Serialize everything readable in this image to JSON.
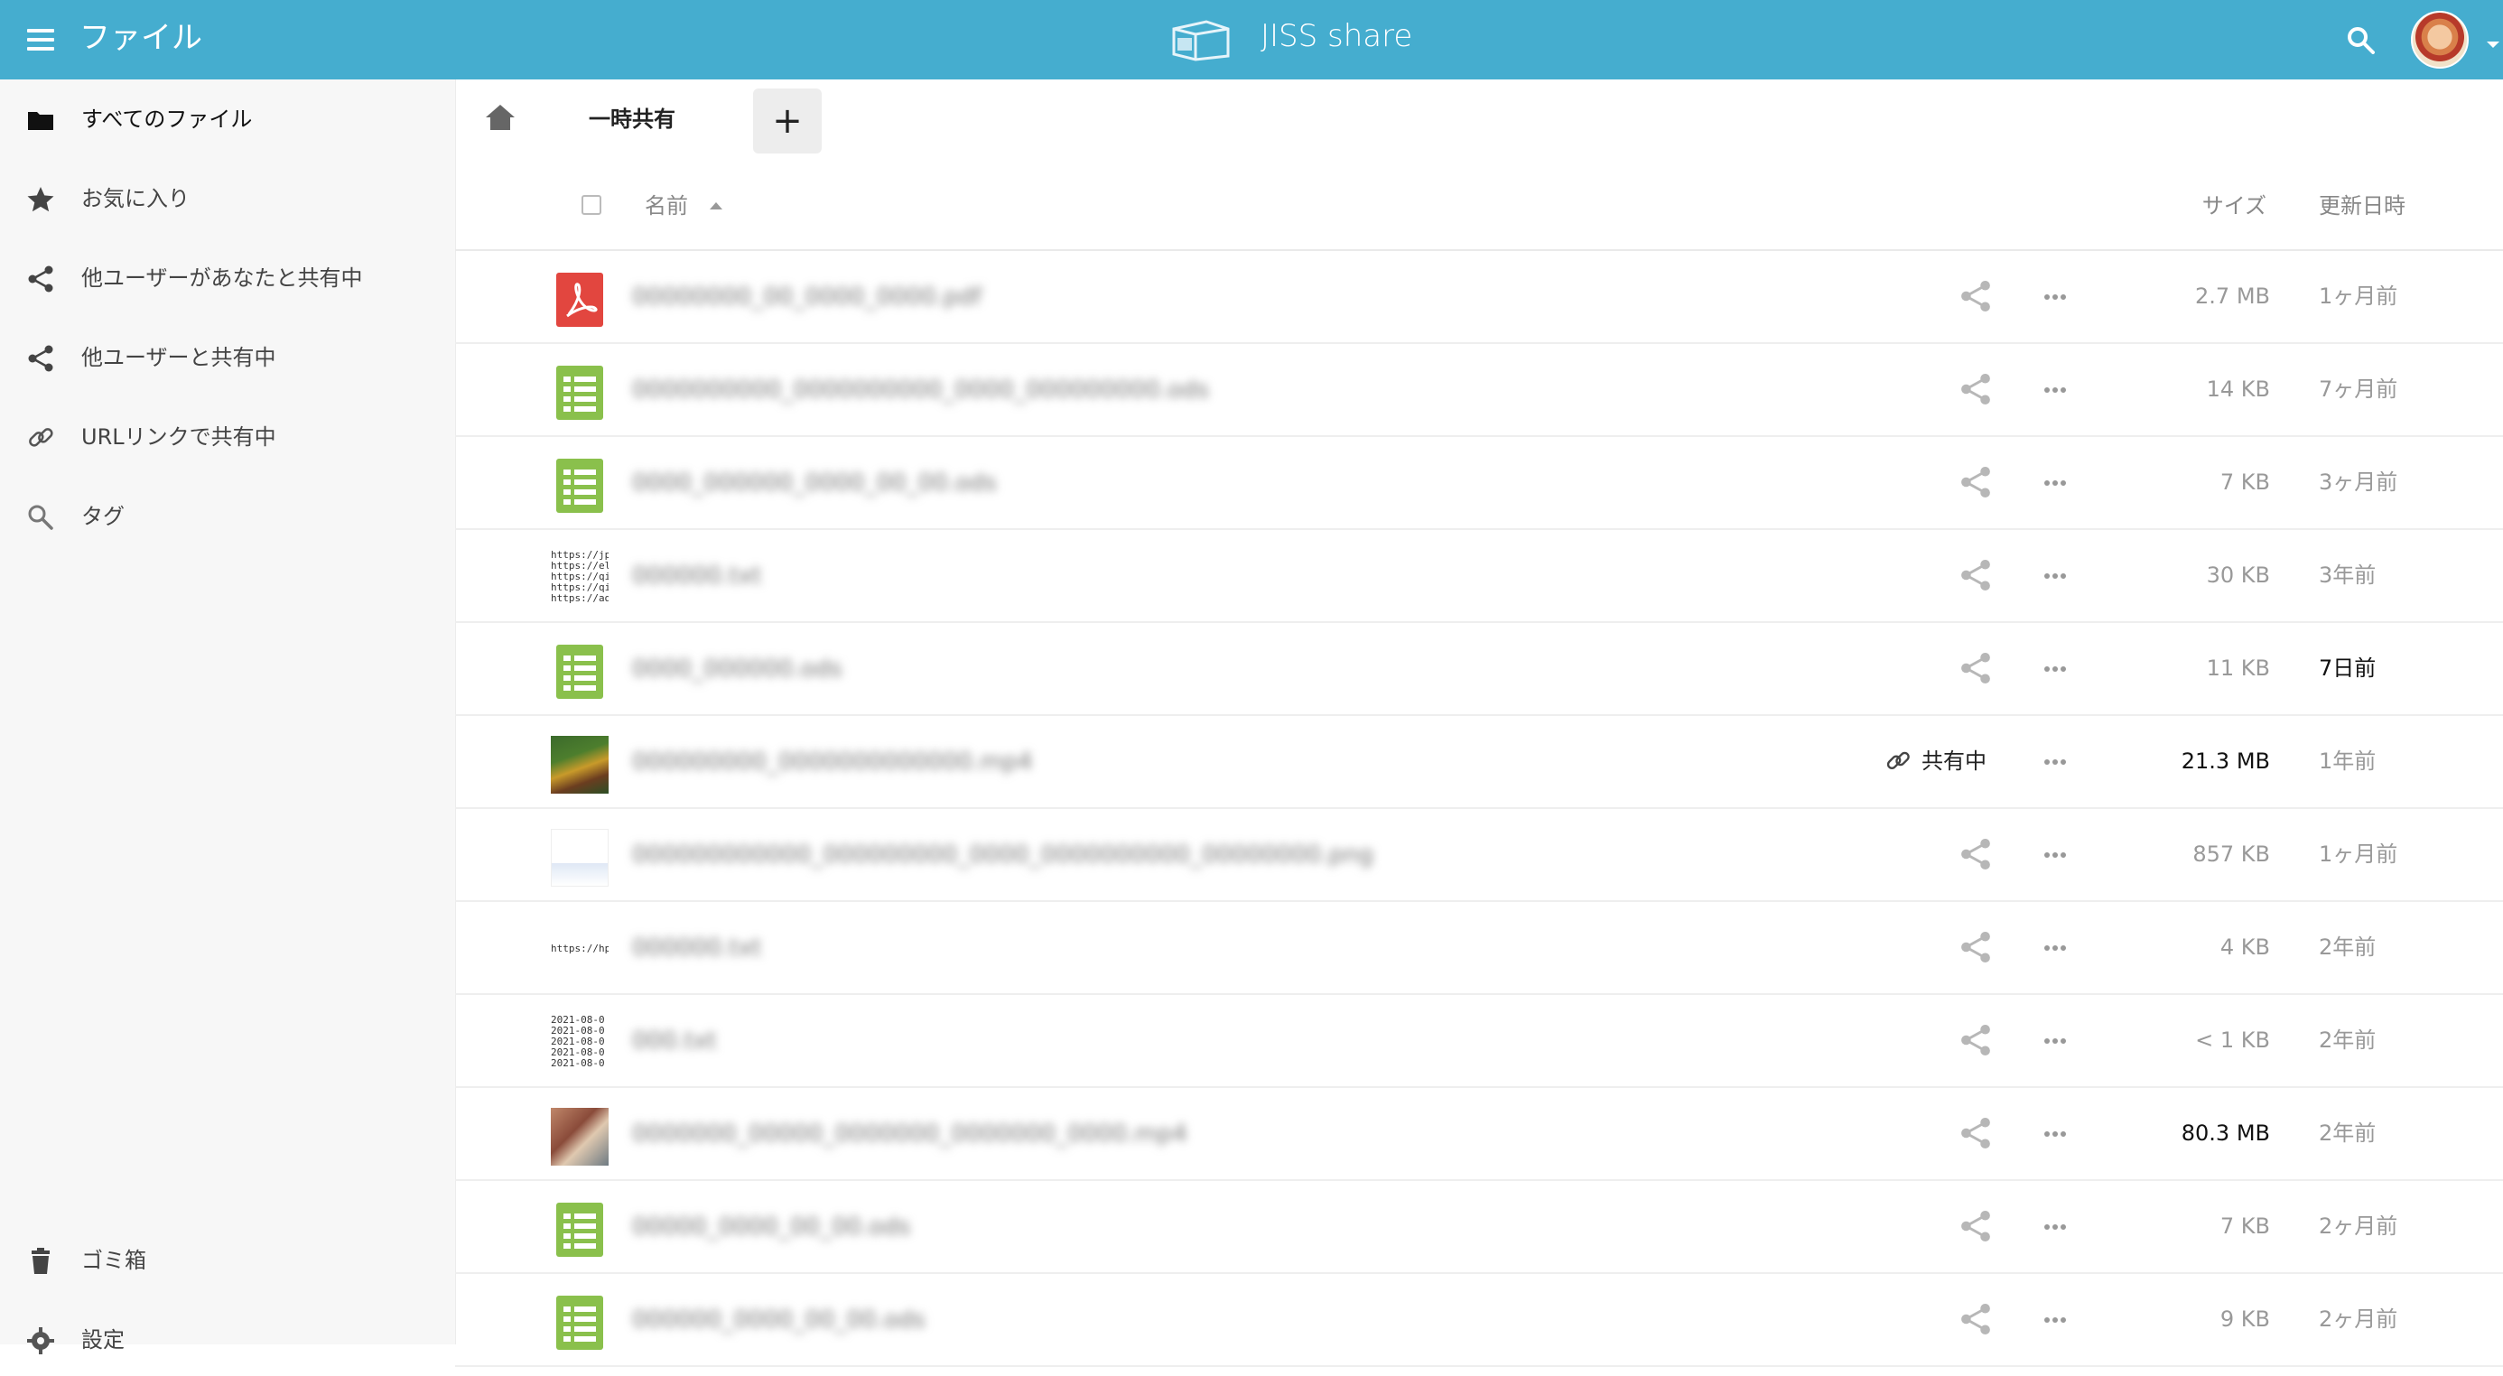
{
  "header": {
    "app_title": "ファイル",
    "brand": "JISS share",
    "accent_color": "#45adcf"
  },
  "sidebar": {
    "items": [
      {
        "label": "すべてのファイル",
        "icon": "folder-icon"
      },
      {
        "label": "お気に入り",
        "icon": "star-icon"
      },
      {
        "label": "他ユーザーがあなたと共有中",
        "icon": "share-icon"
      },
      {
        "label": "他ユーザーと共有中",
        "icon": "share-icon"
      },
      {
        "label": "URLリンクで共有中",
        "icon": "link-icon"
      },
      {
        "label": "タグ",
        "icon": "search-icon"
      }
    ],
    "bottom": [
      {
        "label": "ゴミ箱",
        "icon": "trash-icon"
      },
      {
        "label": "設定",
        "icon": "gear-icon"
      }
    ]
  },
  "breadcrumb": {
    "current": "一時共有",
    "add_label": "+"
  },
  "columns": {
    "name": "名前",
    "size": "サイズ",
    "modified": "更新日時"
  },
  "files": [
    {
      "name": "00000000_00_0000_0000.pdf",
      "type": "pdf",
      "size": "2.7 MB",
      "modified": "1ヶ月前"
    },
    {
      "name": "0000000000_0000000000_0000_000000000.ods",
      "type": "spreadsheet",
      "size": "14 KB",
      "modified": "7ヶ月前"
    },
    {
      "name": "0000_000000_0000_00_00.ods",
      "type": "spreadsheet",
      "size": "7 KB",
      "modified": "3ヶ月前"
    },
    {
      "name": "000000.txt",
      "type": "text",
      "size": "30 KB",
      "modified": "3年前"
    },
    {
      "name": "0000_000000.ods",
      "type": "spreadsheet",
      "size": "11 KB",
      "modified": "7日前",
      "modified_dark": true
    },
    {
      "name": "000000000_0000000000000.mp4",
      "type": "image",
      "size": "21.3 MB",
      "modified": "1年前",
      "shared": true,
      "shared_label": "共有中",
      "size_dark": true
    },
    {
      "name": "000000000000_000000000_0000_0000000000_00000000.png",
      "type": "screenshot",
      "size": "857 KB",
      "modified": "1ヶ月前"
    },
    {
      "name": "000000.txt",
      "type": "text-url",
      "size": "4 KB",
      "modified": "2年前"
    },
    {
      "name": "000.txt",
      "type": "text-dates",
      "size": "< 1 KB",
      "modified": "2年前"
    },
    {
      "name": "0000000_00000_0000000_0000000_0000.mp4",
      "type": "photo",
      "size": "80.3 MB",
      "modified": "2年前",
      "size_dark": true
    },
    {
      "name": "00000_0000_00_00.ods",
      "type": "spreadsheet",
      "size": "7 KB",
      "modified": "2ヶ月前"
    },
    {
      "name": "000000_0000_00_00.ods",
      "type": "spreadsheet",
      "size": "9 KB",
      "modified": "2ヶ月前"
    }
  ],
  "thumb_text": {
    "urls": "https://jp.t\nhttps://ela\nhttps://qiit\nhttps://qiit\nhttps://adv",
    "url_single": "https://hp:",
    "dates": "2021-08-0\n2021-08-0\n2021-08-0\n2021-08-0\n2021-08-0"
  }
}
